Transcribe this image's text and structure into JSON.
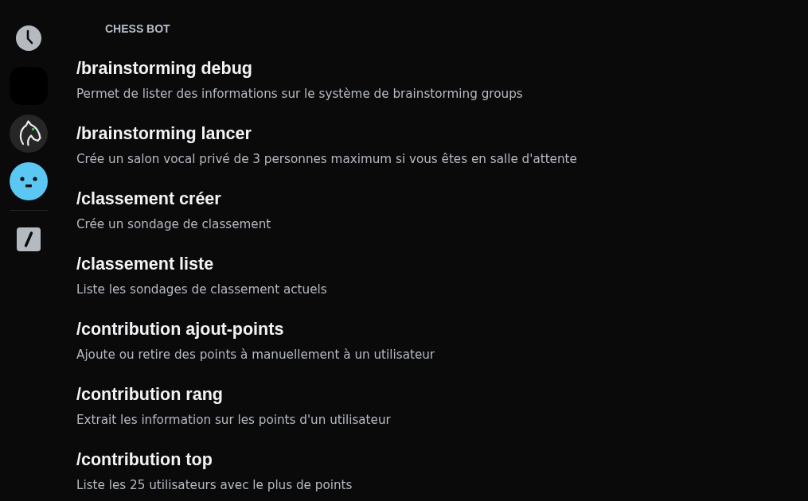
{
  "section": {
    "title": "CHESS BOT"
  },
  "commands": [
    {
      "name": "/brainstorming debug",
      "description": "Permet de lister des informations sur le système de brainstorming groups"
    },
    {
      "name": "/brainstorming lancer",
      "description": "Crée un salon vocal privé de 3 personnes maximum si vous êtes en salle d'attente"
    },
    {
      "name": "/classement créer",
      "description": "Crée un sondage de classement"
    },
    {
      "name": "/classement liste",
      "description": "Liste les sondages de classement actuels"
    },
    {
      "name": "/contribution ajout-points",
      "description": "Ajoute ou retire des points à manuellement à un utilisateur"
    },
    {
      "name": "/contribution rang",
      "description": "Extrait les information sur les points d'un utilisateur"
    },
    {
      "name": "/contribution top",
      "description": "Liste les 25 utilisateurs avec le plus de points"
    }
  ]
}
